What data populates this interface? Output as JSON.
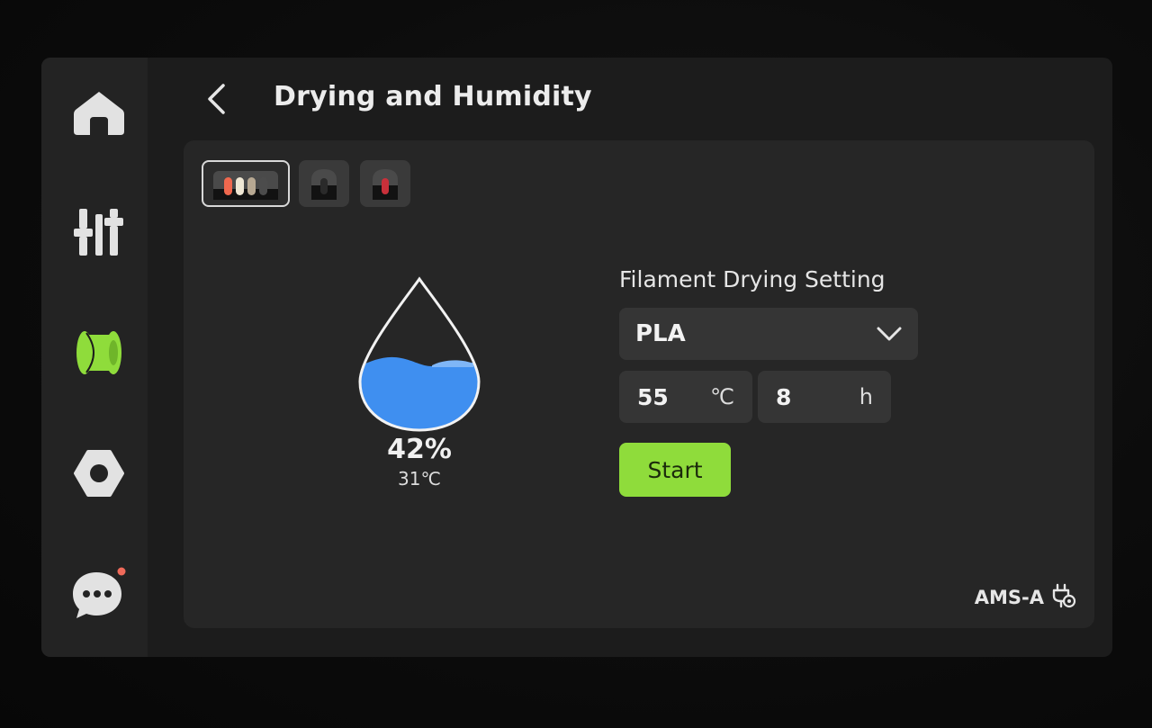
{
  "header": {
    "title": "Drying and Humidity"
  },
  "sidebar": {
    "items": [
      {
        "icon": "home-icon"
      },
      {
        "icon": "sliders-icon"
      },
      {
        "icon": "filament-spool-icon",
        "active": true
      },
      {
        "icon": "hex-nut-settings-icon"
      },
      {
        "icon": "chat-bubble-icon",
        "badge": true
      }
    ]
  },
  "slots": [
    {
      "name": "ams-unit",
      "active": true
    },
    {
      "name": "ext-slot-1",
      "active": false
    },
    {
      "name": "ext-slot-2",
      "active": false
    }
  ],
  "status": {
    "humidity": "42%",
    "temperature": "31℃"
  },
  "drying": {
    "section_title": "Filament Drying Setting",
    "material": "PLA",
    "temp_value": "55",
    "temp_unit": "℃",
    "time_value": "8",
    "time_unit": "h",
    "start_label": "Start"
  },
  "footer": {
    "ams_label": "AMS-A"
  },
  "colors": {
    "accent": "#8fdc3b",
    "water": "#3f8ff0"
  }
}
